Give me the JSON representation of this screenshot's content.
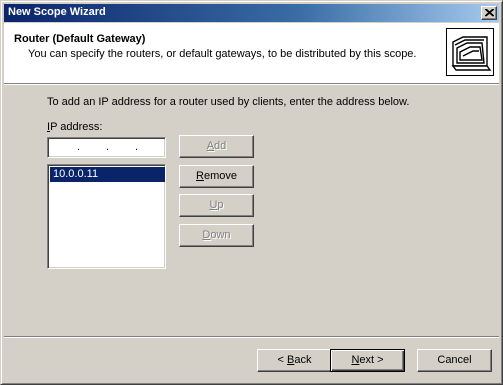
{
  "window": {
    "title": "New Scope Wizard"
  },
  "header": {
    "title": "Router (Default Gateway)",
    "subtitle": "You can specify the routers, or default gateways, to be distributed by this scope."
  },
  "main": {
    "instruction": "To add an IP address for a router used by clients, enter the address below.",
    "ip_label_prefix": "I",
    "ip_label_rest": "P address:",
    "ip_input_value": "",
    "router_list": [
      "10.0.0.11"
    ],
    "selected_index": 0
  },
  "buttons": {
    "add": {
      "accel": "A",
      "rest": "dd",
      "enabled": false
    },
    "remove": {
      "accel": "R",
      "rest": "emove",
      "enabled": true
    },
    "up": {
      "accel": "U",
      "rest": "p",
      "enabled": false
    },
    "down": {
      "accel": "D",
      "rest": "own",
      "enabled": false
    }
  },
  "footer": {
    "back": {
      "prefix": "< ",
      "accel": "B",
      "rest": "ack"
    },
    "next": {
      "accel": "N",
      "rest": "ext >"
    },
    "cancel": "Cancel"
  },
  "colors": {
    "title_bar_start": "#0a246a",
    "title_bar_end": "#a6caf0",
    "selection": "#0a246a",
    "face": "#d4d0c8"
  },
  "icons": {
    "header": "folder-stack-icon",
    "close": "close-icon"
  }
}
